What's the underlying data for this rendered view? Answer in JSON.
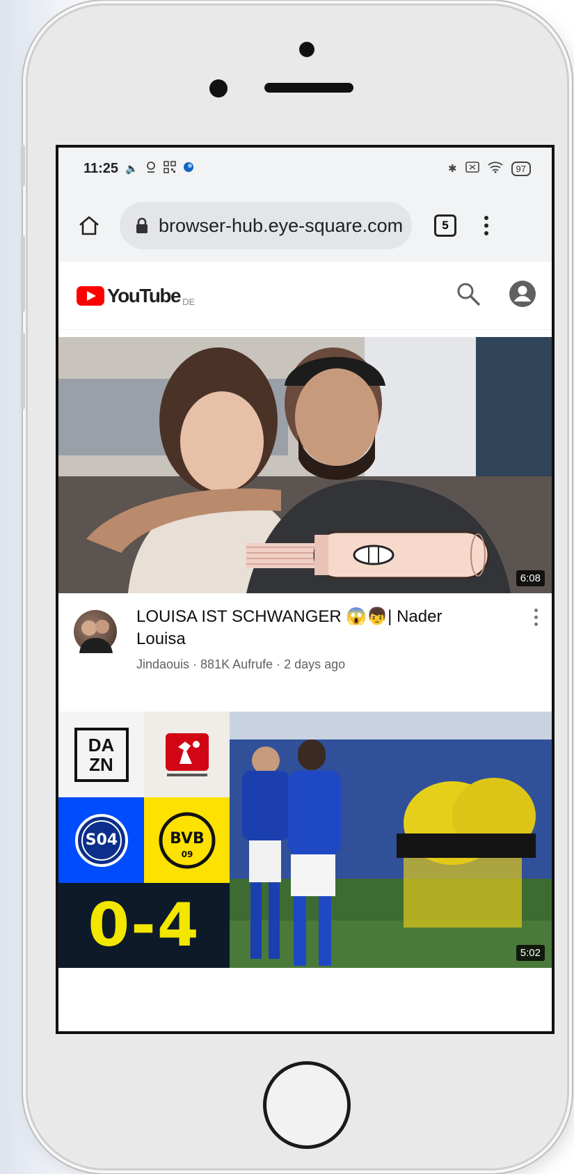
{
  "status_bar": {
    "time": "11:25",
    "battery": "97"
  },
  "browser": {
    "url": "browser-hub.eye-square.com",
    "tab_count": "5"
  },
  "youtube": {
    "logo_text": "YouTube",
    "region": "DE"
  },
  "videos": [
    {
      "title": "LOUISA IST SCHWANGER 😱👦| Nader Louisa",
      "channel_views_age": "Jindaouis · 881K Aufrufe · 2 days ago",
      "duration": "6:08"
    },
    {
      "duration": "5:02",
      "thumbnail_text": {
        "brand_line1": "DA",
        "brand_line2": "ZN",
        "score": "0-4",
        "crest_left": "S04",
        "crest_right": "BVB",
        "crest_right_sub": "09"
      }
    }
  ],
  "colors": {
    "youtube_red": "#ff0000",
    "browser_bar": "#f1f3f4",
    "schalke_blue": "#004cff",
    "bvb_yellow": "#fde100",
    "score_bg": "#0d1a2a"
  },
  "icons": [
    "home-icon",
    "lock-icon",
    "tabs-icon",
    "menu-dots-icon",
    "search-icon",
    "account-icon",
    "more-vert-icon",
    "bluetooth-icon",
    "wifi-icon",
    "battery-icon"
  ]
}
